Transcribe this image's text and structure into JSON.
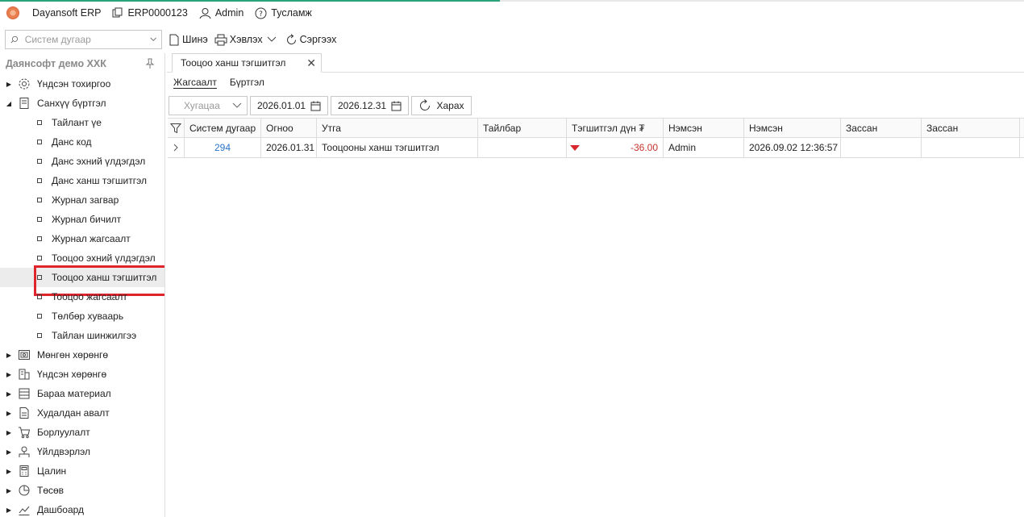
{
  "topbar": {
    "app_name": "Dayansoft ERP",
    "erp_code": "ERP0000123",
    "user": "Admin",
    "help": "Тусламж"
  },
  "toolbar": {
    "search_placeholder": "Систем дугаар",
    "new_label": "Шинэ",
    "print_label": "Хэвлэх",
    "refresh_label": "Сэргээх"
  },
  "sidebar": {
    "company": "Даянсофт демо ХХК",
    "items": [
      {
        "label": "Үндсэн тохиргоо",
        "icon": "gear-icon",
        "expanded": false
      },
      {
        "label": "Санхүү бүртгэл",
        "icon": "ledger-icon",
        "expanded": true,
        "children": [
          "Тайлант үе",
          "Данс код",
          "Данс эхний үлдэгдэл",
          "Данс ханш тэгшитгэл",
          "Журнал загвар",
          "Журнал бичилт",
          "Журнал жагсаалт",
          "Тооцоо эхний үлдэгдэл",
          "Тооцоо ханш тэгшитгэл",
          "Тооцоо жагсаалт",
          "Төлбөр хуваарь",
          "Тайлан шинжилгээ"
        ]
      },
      {
        "label": "Мөнгөн хөрөнгө",
        "icon": "cash-icon",
        "expanded": false
      },
      {
        "label": "Үндсэн хөрөнгө",
        "icon": "building-icon",
        "expanded": false
      },
      {
        "label": "Бараа материал",
        "icon": "inventory-icon",
        "expanded": false
      },
      {
        "label": "Худалдан авалт",
        "icon": "purchase-icon",
        "expanded": false
      },
      {
        "label": "Борлуулалт",
        "icon": "cart-icon",
        "expanded": false
      },
      {
        "label": "Үйлдвэрлэл",
        "icon": "factory-icon",
        "expanded": false
      },
      {
        "label": "Цалин",
        "icon": "calculator-icon",
        "expanded": false
      },
      {
        "label": "Төсөв",
        "icon": "pie-icon",
        "expanded": false
      },
      {
        "label": "Дашбоард",
        "icon": "dashboard-icon",
        "expanded": false
      }
    ]
  },
  "document_tab": {
    "title": "Тооцоо ханш тэгшитгэл"
  },
  "subtabs": [
    "Жагсаалт",
    "Бүртгэл"
  ],
  "filters": {
    "period_placeholder": "Хугацаа",
    "date_from": "2026.01.01",
    "date_to": "2026.12.31",
    "view_label": "Харах"
  },
  "grid": {
    "columns": [
      "Систем дугаар",
      "Огноо",
      "Утга",
      "Тайлбар",
      "Тэгшитгэл дүн ₮",
      "Нэмсэн",
      "Нэмсэн",
      "Зассан",
      "Зассан"
    ],
    "rows": [
      [
        "294",
        "2026.01.31",
        "Тооцооны ханш тэгшитгэл",
        "",
        "-36.00",
        "Admin",
        "2026.09.02 12:36:57",
        "",
        ""
      ]
    ]
  },
  "colors": {
    "accent": "#2aa37a",
    "link": "#2a74c8",
    "negative": "#c8352f",
    "highlight": "#e0242c"
  }
}
